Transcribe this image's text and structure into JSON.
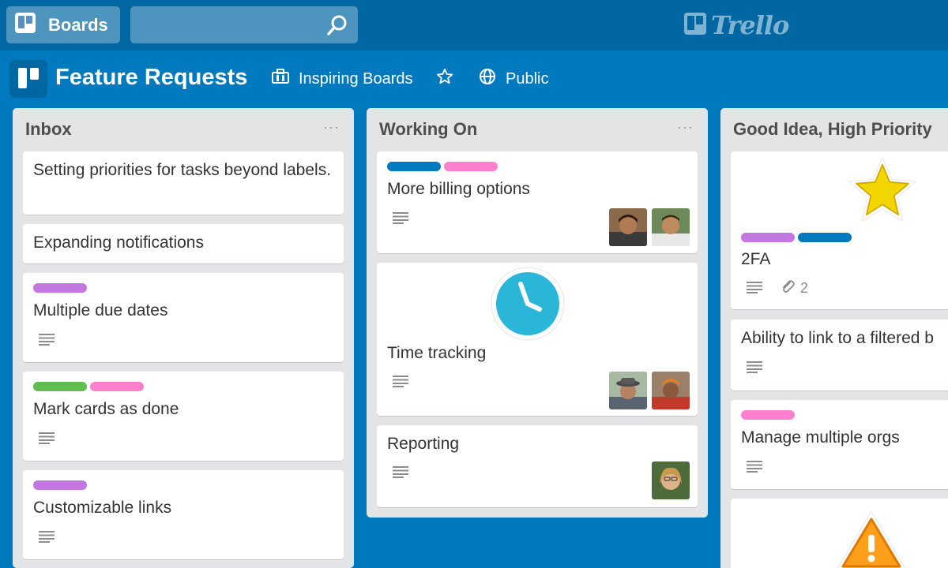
{
  "topbar": {
    "boards_label": "Boards",
    "search_placeholder": "",
    "logo_text": "Trello"
  },
  "board": {
    "title": "Feature Requests",
    "team": "Inspiring Boards",
    "visibility": "Public"
  },
  "colors": {
    "blue_label": "#0079bf",
    "pink_label": "#ff80ce",
    "purple_label": "#c377e0",
    "green_label": "#61bd4f",
    "orange_badge": "#ff9f1a",
    "clock_blue": "#29b6d8",
    "star_yellow": "#f2d600"
  },
  "lists": [
    {
      "title": "Inbox",
      "menu": "···",
      "cards": [
        {
          "title": "Setting priorities for tasks beyond labels."
        },
        {
          "title": "Expanding notifications"
        },
        {
          "title": "Multiple due dates",
          "labels": [
            "purple"
          ],
          "has_description": true
        },
        {
          "title": "Mark cards as done",
          "labels": [
            "green",
            "pink"
          ],
          "has_description": true
        },
        {
          "title": "Customizable links",
          "labels": [
            "purple"
          ],
          "has_description": true
        }
      ]
    },
    {
      "title": "Working On",
      "menu": "···",
      "cards": [
        {
          "title": "More billing options",
          "labels": [
            "blue",
            "pink"
          ],
          "has_description": true,
          "members": 2
        },
        {
          "title": "Time tracking",
          "cover": "clock-sticker",
          "has_description": true,
          "members": 2
        },
        {
          "title": "Reporting",
          "has_description": true,
          "members": 1
        }
      ]
    },
    {
      "title": "Good Idea, High Priority",
      "cards": [
        {
          "title": "2FA",
          "cover": "star-sticker",
          "labels": [
            "purple",
            "blue"
          ],
          "has_description": true,
          "attachments": "2"
        },
        {
          "title": "Ability to link to a filtered b",
          "has_description": true
        },
        {
          "title": "Manage multiple orgs",
          "labels": [
            "pink"
          ],
          "has_description": true
        },
        {
          "title": "",
          "cover": "warning-sticker"
        }
      ]
    }
  ]
}
